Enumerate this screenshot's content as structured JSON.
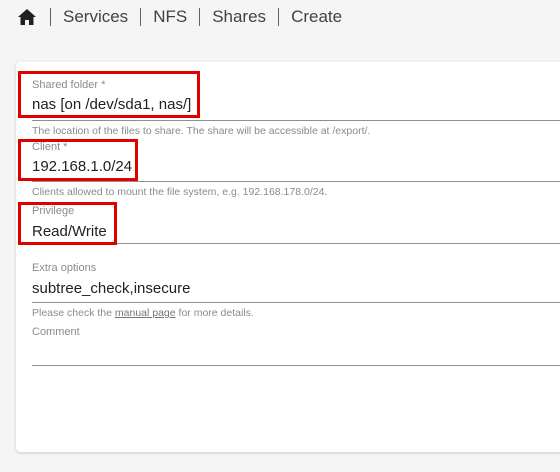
{
  "breadcrumb": {
    "home_icon": "home-icon",
    "items": [
      "Services",
      "NFS",
      "Shares",
      "Create"
    ]
  },
  "form": {
    "shared_folder": {
      "label": "Shared folder *",
      "value": "nas [on /dev/sda1, nas/]",
      "hint": "The location of the files to share. The share will be accessible at /export/."
    },
    "client": {
      "label": "Client *",
      "value": "192.168.1.0/24",
      "hint": "Clients allowed to mount the file system, e.g. 192.168.178.0/24."
    },
    "privilege": {
      "label": "Privilege",
      "value": "Read/Write"
    },
    "extra_options": {
      "label": "Extra options",
      "value": "subtree_check,insecure",
      "hint_prefix": "Please check the ",
      "hint_link": "manual page",
      "hint_suffix": " for more details."
    },
    "comment": {
      "label": "Comment",
      "value": ""
    }
  },
  "colors": {
    "highlight": "#e00000",
    "background": "#f5f5f5",
    "card": "#ffffff"
  }
}
